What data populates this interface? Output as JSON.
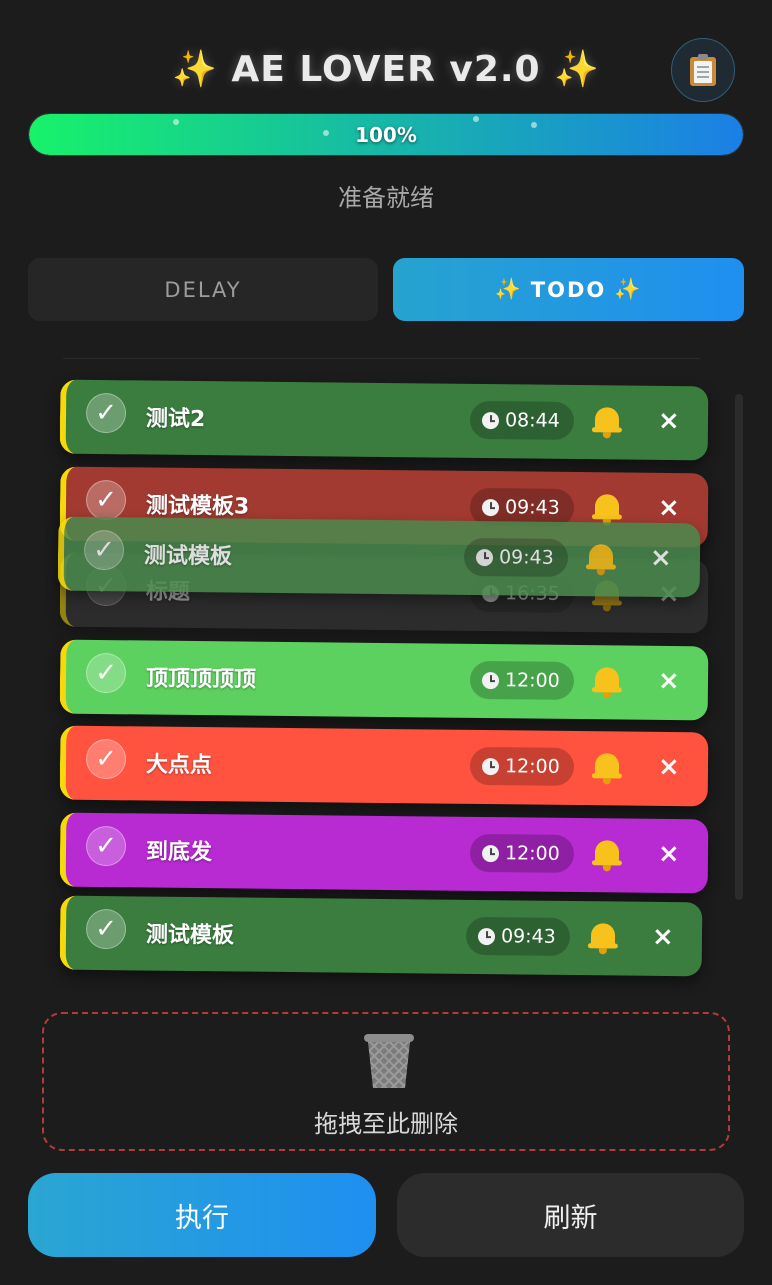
{
  "header": {
    "spark_left": "✨",
    "title": "AE LOVER v2.0",
    "spark_right": "✨",
    "clipboard_icon": "clipboard-icon"
  },
  "progress": {
    "percent": 100,
    "label": "100%"
  },
  "status_text": "准备就绪",
  "tabs": {
    "delay_label": "DELAY",
    "todo_spark": "✨",
    "todo_label": "TODO",
    "active": "todo"
  },
  "items": [
    {
      "name": "测试2",
      "time": "08:44",
      "color": "#3a7d3f",
      "check": "✓",
      "close": "×"
    },
    {
      "name": "测试模板3",
      "time": "09:43",
      "color": "#a33a31",
      "check": "✓",
      "close": "×"
    },
    {
      "name": "标题",
      "time": "16:35",
      "color": "#3a3a3a",
      "check": "✓",
      "close": "×"
    },
    {
      "name": "顶顶顶顶顶",
      "time": "12:00",
      "color": "#5cd15f",
      "check": "✓",
      "close": "×"
    },
    {
      "name": "大点点",
      "time": "12:00",
      "color": "#ff5340",
      "check": "✓",
      "close": "×"
    },
    {
      "name": "到底发",
      "time": "12:00",
      "color": "#b82ad2",
      "check": "✓",
      "close": "×"
    },
    {
      "name": "测试模板",
      "time": "09:43",
      "color": "#3a7d3f",
      "check": "✓",
      "close": "×"
    }
  ],
  "dragging_item": {
    "name": "测试模板",
    "time": "09:43",
    "color": "#4a8a4e",
    "check": "✓",
    "close": "×"
  },
  "dropzone": {
    "icon": "trash-icon",
    "label": "拖拽至此删除"
  },
  "buttons": {
    "execute": "执行",
    "refresh": "刷新"
  }
}
